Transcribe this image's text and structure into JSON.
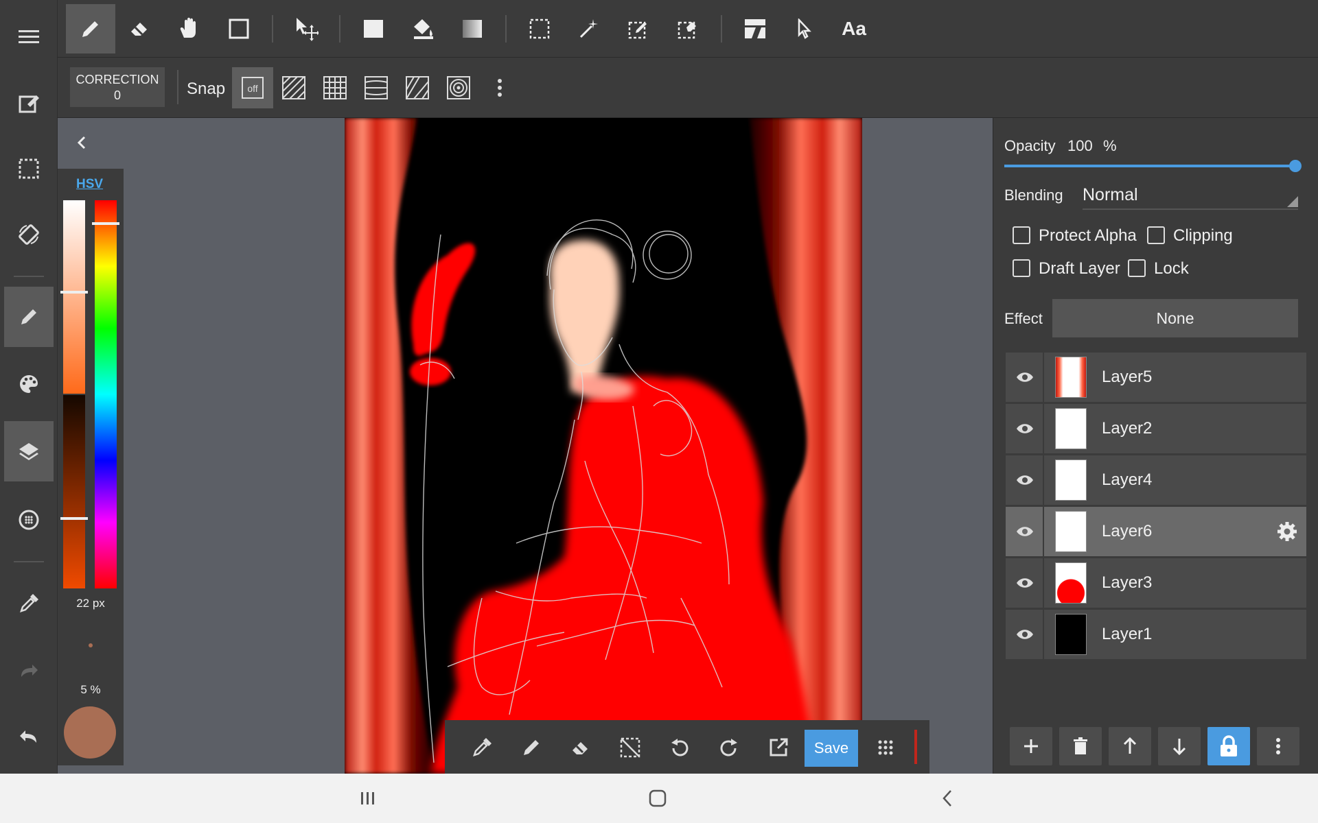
{
  "top_toolbar": {
    "font_tool_label": "Aa",
    "tools": [
      "pen-icon",
      "eraser-icon",
      "hand-icon",
      "rectangle-icon",
      "move-icon",
      "fill-rect-icon",
      "bucket-icon",
      "gradient-icon",
      "selection-icon",
      "magic-wand-icon",
      "select-pen-icon",
      "select-eraser-icon",
      "layer-transform-icon",
      "pointer-icon",
      "text-icon"
    ]
  },
  "sub_toolbar": {
    "correction_label": "CORRECTION",
    "correction_value": "0",
    "snap_label": "Snap",
    "snap_off": "off"
  },
  "color_panel": {
    "mode_label": "HSV",
    "brush_size": "22 px",
    "brush_opacity": "5 %",
    "current_color": "#a96e54"
  },
  "right_panel": {
    "opacity_label": "Opacity",
    "opacity_value": "100",
    "opacity_unit": "%",
    "opacity_fraction": 1.0,
    "blending_label": "Blending",
    "blending_value": "Normal",
    "protect_alpha": "Protect Alpha",
    "clipping": "Clipping",
    "draft_layer": "Draft Layer",
    "lock": "Lock",
    "effect_label": "Effect",
    "effect_value": "None",
    "layers": [
      {
        "name": "Layer5",
        "selected": false
      },
      {
        "name": "Layer2",
        "selected": false
      },
      {
        "name": "Layer4",
        "selected": false
      },
      {
        "name": "Layer6",
        "selected": true
      },
      {
        "name": "Layer3",
        "selected": false
      },
      {
        "name": "Layer1",
        "selected": false
      }
    ]
  },
  "action_bar": {
    "save_label": "Save"
  },
  "colors": {
    "accent": "#4a9be0",
    "panel": "#3b3b3b",
    "canvas_bg": "#5c5f66",
    "red": "#ff0000"
  }
}
